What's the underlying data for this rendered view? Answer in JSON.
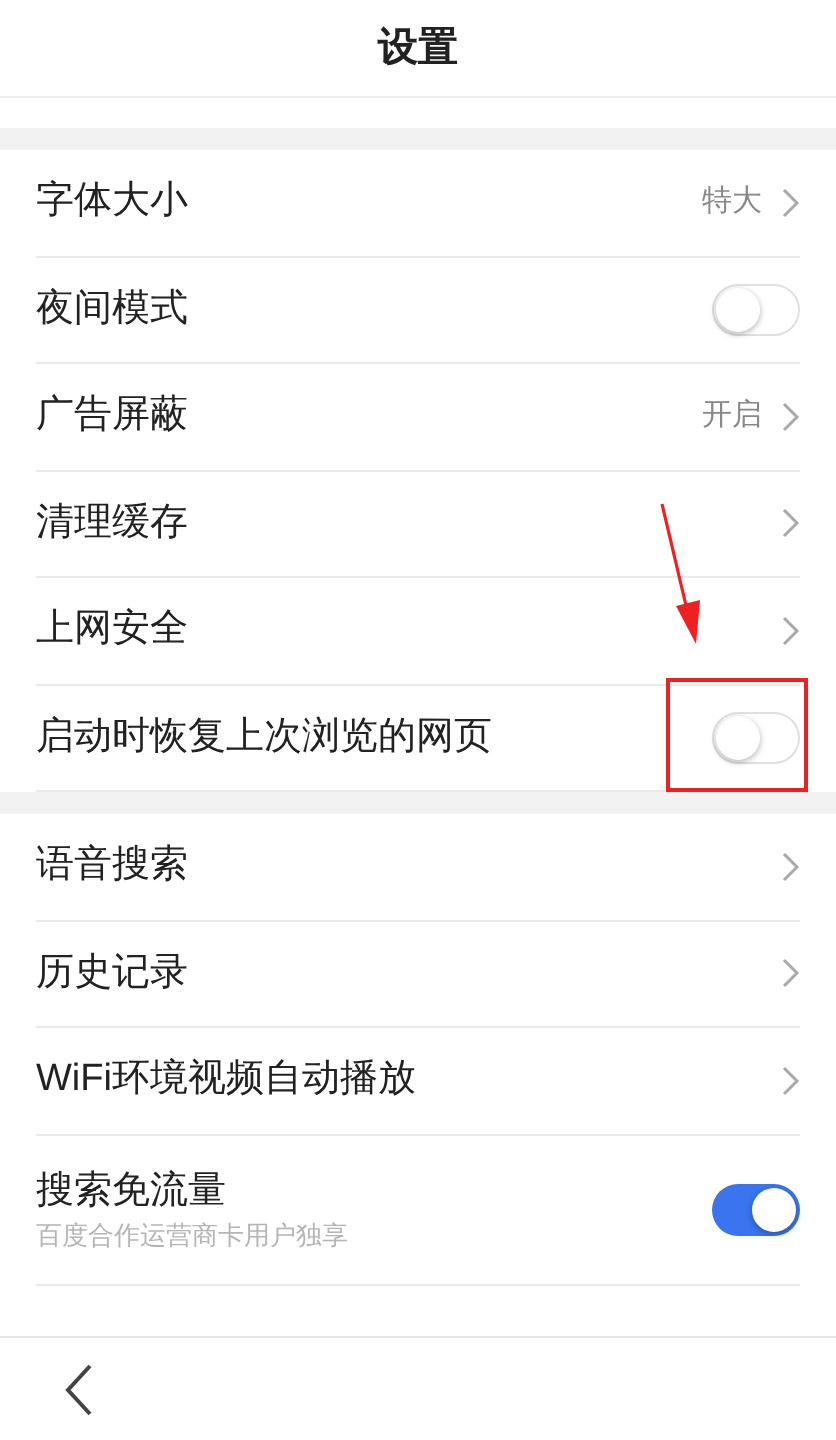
{
  "header": {
    "title": "设置"
  },
  "groups": [
    {
      "rows": [
        {
          "kind": "value",
          "label": "字体大小",
          "value": "特大",
          "highlighted": false
        },
        {
          "kind": "toggle",
          "label": "夜间模式",
          "on": false,
          "highlighted": false
        },
        {
          "kind": "value",
          "label": "广告屏蔽",
          "value": "开启",
          "highlighted": false
        },
        {
          "kind": "link",
          "label": "清理缓存",
          "highlighted": false
        },
        {
          "kind": "link",
          "label": "上网安全",
          "highlighted": false
        },
        {
          "kind": "toggle",
          "label": "启动时恢复上次浏览的网页",
          "on": false,
          "highlighted": true
        }
      ]
    },
    {
      "rows": [
        {
          "kind": "link",
          "label": "语音搜索",
          "highlighted": false
        },
        {
          "kind": "link",
          "label": "历史记录",
          "highlighted": false
        },
        {
          "kind": "link",
          "label": "WiFi环境视频自动播放",
          "highlighted": false
        },
        {
          "kind": "toggle",
          "label": "搜索免流量",
          "sublabel": "百度合作运营商卡用户独享",
          "on": true,
          "highlighted": false
        }
      ]
    }
  ]
}
